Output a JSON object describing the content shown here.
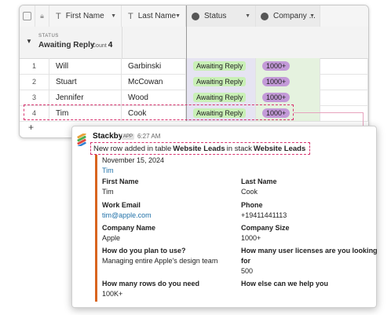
{
  "sheet": {
    "headers": {
      "first_name": "First Name",
      "last_name": "Last Name",
      "status": "Status",
      "company": "Company ..."
    },
    "group": {
      "field": "STATUS",
      "value": "Awaiting Reply",
      "count_label": "Count",
      "count": "4"
    },
    "rows": [
      {
        "num": "1",
        "first": "Will",
        "last": "Garbinski",
        "status": "Awaiting Reply",
        "company": "1000+"
      },
      {
        "num": "2",
        "first": "Stuart",
        "last": "McCowan",
        "status": "Awaiting Reply",
        "company": "1000+"
      },
      {
        "num": "3",
        "first": "Jennifer",
        "last": "Wood",
        "status": "Awaiting Reply",
        "company": "1000+"
      },
      {
        "num": "4",
        "first": "Tim",
        "last": "Cook",
        "status": "Awaiting Reply",
        "company": "1000+"
      }
    ],
    "add_symbol": "+"
  },
  "notification": {
    "bot_name": "Stackby",
    "badge": "APP",
    "time": "6:27 AM",
    "message": {
      "prefix": "New row added in table",
      "table": "Website Leads",
      "middle": "in stack",
      "stack": "Website Leads"
    },
    "date": "November 15, 2024",
    "title_link": "Tim",
    "fields": [
      {
        "label": "First Name",
        "value": "Tim"
      },
      {
        "label": "Last Name",
        "value": "Cook"
      },
      {
        "label": "Work Email",
        "value": "tim@apple.com"
      },
      {
        "label": "Phone",
        "value": "+19411441113"
      },
      {
        "label": "Company Name",
        "value": "Apple"
      },
      {
        "label": "Company Size",
        "value": "1000+"
      },
      {
        "label": "How do you plan to use?",
        "value": "Managing entire Apple's design team"
      },
      {
        "label": "How many user licenses are you looking for",
        "label_line1": "How many user licenses are you looking",
        "label_line2": "for",
        "value": "500"
      },
      {
        "label": "How many rows do you need",
        "value": "100K+"
      },
      {
        "label": "How else can we help you",
        "value": ""
      }
    ]
  },
  "colors": {
    "highlight_dash": "#d8336f",
    "accent_bar": "#d9651f",
    "link": "#2272a9",
    "status_pill": "#c9f0b6",
    "company_pill": "#c39ad8"
  },
  "icons": [
    "checkbox-icon",
    "lock-icon",
    "text-field-icon",
    "dropdown-caret-icon",
    "single-select-icon",
    "collapse-triangle-icon",
    "add-row-icon",
    "stackby-logo"
  ]
}
